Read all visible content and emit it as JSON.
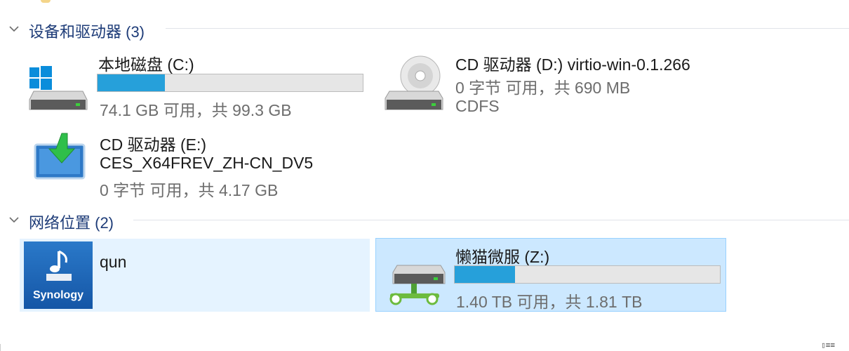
{
  "groups": {
    "devices": {
      "title": "设备和驱动器 (3)"
    },
    "network": {
      "title": "网络位置 (2)"
    }
  },
  "drives": {
    "c": {
      "name": "本地磁盘 (C:)",
      "usage": 0.254,
      "free_text": "74.1 GB 可用，共 99.3 GB"
    },
    "d": {
      "name": "CD 驱动器 (D:) virtio-win-0.1.266",
      "free_text": "0 字节 可用，共 690 MB",
      "fs": "CDFS"
    },
    "e": {
      "name": "CD 驱动器 (E:)",
      "label": "CES_X64FREV_ZH-CN_DV5",
      "free_text": "0 字节 可用，共 4.17 GB"
    }
  },
  "network": {
    "qun": {
      "name": "qun",
      "logo_text": "Synology"
    },
    "z": {
      "name": "懒猫微服 (Z:)",
      "usage": 0.227,
      "free_text": "1.40 TB 可用，共 1.81 TB"
    }
  },
  "colors": {
    "bar_fill": "#26a0da",
    "group_title": "#1e3c78",
    "selected_bg": "#cce8ff",
    "hover_bg": "#e5f3ff"
  },
  "icons": [
    "chevron-down-icon",
    "windows-drive-icon",
    "cd-drive-icon",
    "install-disc-icon",
    "synology-nas-icon",
    "network-drive-icon",
    "details-view-icon"
  ]
}
